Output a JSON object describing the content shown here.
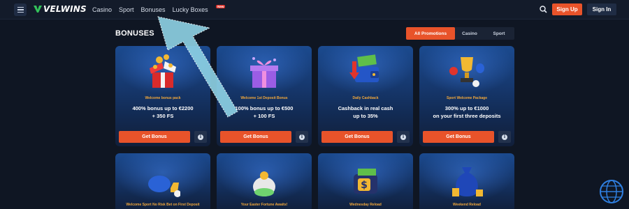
{
  "header": {
    "logo_text": "VELWINS",
    "nav": [
      "Casino",
      "Sport",
      "Bonuses",
      "Lucky Boxes"
    ],
    "new_badge": "New",
    "signup_label": "Sign Up",
    "signin_label": "Sign In"
  },
  "page": {
    "title": "BONUSES",
    "filters": [
      "All Promotions",
      "Casino",
      "Sport"
    ],
    "active_filter": "All Promotions"
  },
  "cards": [
    {
      "subtitle": "Welcome bonus pack",
      "line1": "400% bonus up to €2200",
      "line2": "+ 350 FS",
      "cta": "Get Bonus",
      "art": "gift-box-icon"
    },
    {
      "subtitle": "Welcome 1st Deposit Bonus",
      "line1": "100% bonus up to €500",
      "line2": "+ 100 FS",
      "cta": "Get Bonus",
      "art": "gift-icon"
    },
    {
      "subtitle": "Daily Cashback",
      "line1": "Cashback in real cash",
      "line2": "up to 35%",
      "cta": "Get Bonus",
      "art": "wallet-icon"
    },
    {
      "subtitle": "Sport Welcome Package",
      "line1": "300% up to €1000",
      "line2": "on your first three deposits",
      "cta": "Get Bonus",
      "art": "trophy-icon"
    },
    {
      "subtitle": "Welcome Sport No Risk Bet on First Deposit",
      "art": "sports-bag-icon"
    },
    {
      "subtitle": "Your Easter Fortune Awaits!",
      "art": "easter-egg-icon"
    },
    {
      "subtitle": "Wednesday Reload",
      "art": "dollar-wallet-icon"
    },
    {
      "subtitle": "Weekend Reload",
      "art": "money-bag-icon"
    }
  ],
  "colors": {
    "accent": "#e8532a",
    "brand": "#33c25a",
    "background": "#0f1623",
    "card_top": "#1b4a8f",
    "arrow": "#8fd3e6"
  }
}
